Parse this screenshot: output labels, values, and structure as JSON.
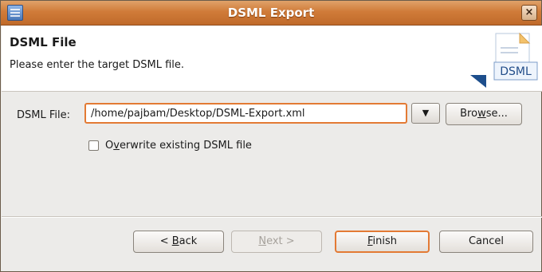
{
  "window": {
    "title": "DSML Export",
    "close_label": "×"
  },
  "header": {
    "title": "DSML File",
    "description": "Please enter the target DSML file.",
    "banner_text": "DSML"
  },
  "form": {
    "file_label": "DSML File:",
    "file_value": "/home/pajbam/Desktop/DSML-Export.xml",
    "dropdown_glyph": "▼",
    "browse_label_pre": "Bro",
    "browse_label_mnemonic": "w",
    "browse_label_post": "se...",
    "overwrite_pre": "O",
    "overwrite_mnemonic": "v",
    "overwrite_post": "erwrite existing DSML file",
    "overwrite_checked": false
  },
  "buttons": {
    "back_pre": "< ",
    "back_mnemonic": "B",
    "back_post": "ack",
    "next_mnemonic": "N",
    "next_post": "ext >",
    "finish_mnemonic": "F",
    "finish_post": "inish",
    "cancel": "Cancel"
  },
  "colors": {
    "titlebar": "#d07b39",
    "focus": "#e37a34",
    "background": "#ecebe9"
  },
  "icons": {
    "app": "ldap-browser-icon",
    "banner": "dsml-document-icon"
  }
}
